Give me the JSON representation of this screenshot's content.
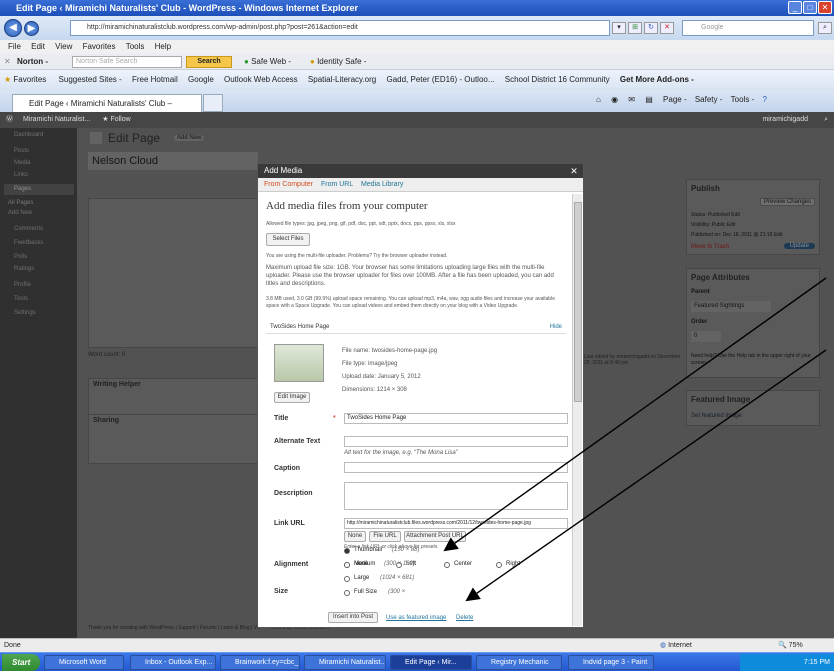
{
  "window": {
    "title": "Edit Page ‹ Miramichi Naturalists' Club - WordPress - Windows Internet Explorer"
  },
  "browser": {
    "url": "http://miramichinaturalistclub.wordpress.com/wp-admin/post.php?post=261&action=edit",
    "search_placeholder": "Google",
    "menu": [
      "File",
      "Edit",
      "View",
      "Favorites",
      "Tools",
      "Help"
    ],
    "norton": {
      "label": "Norton -",
      "search_placeholder": "Norton Safe Search",
      "search_button": "Search",
      "safe_web": "Safe Web -",
      "identity_safe": "Identity Safe -"
    },
    "favorites": [
      "Favorites",
      "Suggested Sites -",
      "Free Hotmail",
      "Google",
      "Outlook Web Access",
      "Spatial-Literacy.org",
      "Gadd, Peter (ED16) - Outloo...",
      "School District 16 Community",
      "Get More Add-ons -"
    ],
    "tab_title": "Edit Page ‹ Miramichi Naturalists' Club – WordPress",
    "cmd_items": [
      "Page -",
      "Safety -",
      "Tools -"
    ],
    "status": "Done",
    "zone": "Internet",
    "zoom": "75%"
  },
  "wp": {
    "admin_bar": {
      "site": "Miramichi Naturalist...",
      "follow": "Follow",
      "user": "miramichigadd"
    },
    "page_heading": "Edit Page",
    "add_new": "Add New",
    "post_title": "Nelson Cloud",
    "sidebar": [
      "Dashboard",
      "Posts",
      "Media",
      "Links",
      "Pages",
      "All Pages",
      "Add New",
      "Comments",
      "Feedbacks",
      "Polls",
      "Ratings",
      "Profile",
      "Tools",
      "Settings"
    ],
    "publish": {
      "title": "Publish",
      "preview": "Preview Changes",
      "status": "Status: Published Edit",
      "visibility": "Visibility: Public Edit",
      "published_on": "Published on: Dec 18, 2011 @ 21:18 Edit",
      "trash": "Move to Trash",
      "update": "Update"
    },
    "attributes": {
      "title": "Page Attributes",
      "parent": "Parent",
      "parent_value": "Featured Sightings",
      "order": "Order",
      "order_value": "0"
    },
    "help": "Need help? Use the Help tab in the upper right of your screen.",
    "featured": {
      "title": "Featured Image",
      "link": "Set featured image"
    },
    "word_count": "Word count: 0",
    "last_edited": "Last edited by miramichigadd on December 28, 2011 at 8:49 pm",
    "boxes": [
      "Writing Helper",
      "Sharing"
    ],
    "footer": "Thank you for creating with WordPress | Support | Forums | Learn & Blog | VIP — Hosted by WordPress.com"
  },
  "modal": {
    "title": "Add Media",
    "tabs": [
      "From Computer",
      "From URL",
      "Media Library"
    ],
    "heading": "Add media files from your computer",
    "allowed": "Allowed file types: jpg, jpeg, png, gif, pdf, doc, ppt, odt, pptx, docx, pps, ppsx, xls, xlsx",
    "select_files": "Select Files",
    "multi_note": "You are using the multi-file uploader. Problems? Try the browser uploader instead.",
    "max_size": "Maximum upload file size: 1GB. Your browser has some limitations uploading large files with the multi-file uploader. Please use the browser uploader for files over 100MB. After a file has been uploaded, you can add titles and descriptions.",
    "space": "3.8 MB used, 3.0 GB (99.9%) upload space remaining. You can upload mp3, m4a, wav, ogg audio files and increase your available space with a Space Upgrade. You can upload videos and embed them directly on your blog with a Video Upgrade.",
    "file_item": "TwoSides Home Page",
    "hide": "Hide",
    "file_name": "File name: twosides-home-page.jpg",
    "file_type": "File type: image/jpeg",
    "upload_date": "Upload date: January 5, 2012",
    "dimensions": "Dimensions: 1214 × 308",
    "edit_image": "Edit Image",
    "labels": {
      "title": "Title",
      "alt": "Alternate Text",
      "caption": "Caption",
      "description": "Description",
      "link": "Link URL",
      "alignment": "Alignment",
      "size": "Size"
    },
    "required": "*",
    "title_value": "TwoSides Home Page",
    "alt_hint": "Alt text for the image, e.g. “The Mona Lisa”",
    "link_value": "http://miramichinaturalistclub.files.wordpress.com/2011/12/twosides-home-page.jpg",
    "link_buttons": [
      "None",
      "File URL",
      "Attachment Post URL"
    ],
    "link_hint": "Enter a link URL or click above for presets.",
    "alignments": [
      "None",
      "Left",
      "Center",
      "Right"
    ],
    "sizes": [
      {
        "label": "Thumbnail",
        "dims": "(150 × 88)"
      },
      {
        "label": "Medium",
        "dims": "(300 × 189)"
      },
      {
        "label": "Large",
        "dims": "(1024 × 681)"
      },
      {
        "label": "Full Size",
        "dims": "(300 ×"
      }
    ],
    "insert": "Insert into Post",
    "featured": "Use as featured image",
    "delete": "Delete"
  },
  "taskbar": {
    "start": "Start",
    "items": [
      "Microsoft Word",
      "Inbox - Outlook Exp...",
      "Brainwork:f.ey=cbc_...",
      "Miramichi Naturalist...",
      "Edit Page ‹ Mir...",
      "Registry Mechanic",
      "Indvid page 3 - Paint"
    ],
    "clock": "7:15 PM"
  }
}
